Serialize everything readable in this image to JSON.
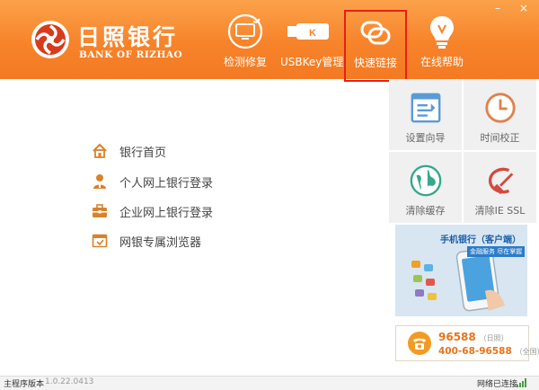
{
  "brand": {
    "name_cn": "日照银行",
    "name_en": "BANK OF RIZHAO",
    "accent": "#f7832a",
    "logo_red": "#d83a1c"
  },
  "window_controls": {
    "minimize": "–",
    "close": "×"
  },
  "toolbar": [
    {
      "label": "检测修复",
      "icon": "monitor-refresh-icon"
    },
    {
      "label": "USBKey管理",
      "icon": "usbkey-icon",
      "key_letter": "K"
    },
    {
      "label": "快速链接",
      "icon": "link-icon",
      "selected": true
    },
    {
      "label": "在线帮助",
      "icon": "lightbulb-icon"
    }
  ],
  "menu": [
    {
      "label": "银行首页",
      "icon": "home-icon"
    },
    {
      "label": "个人网上银行登录",
      "icon": "person-icon"
    },
    {
      "label": "企业网上银行登录",
      "icon": "briefcase-icon"
    },
    {
      "label": "网银专属浏览器",
      "icon": "browser-icon"
    }
  ],
  "tiles": [
    {
      "label": "设置向导",
      "icon": "wizard-icon"
    },
    {
      "label": "时间校正",
      "icon": "clock-icon"
    },
    {
      "label": "清除缓存",
      "icon": "globe-icon"
    },
    {
      "label": "清除IE SSL",
      "icon": "broom-icon"
    }
  ],
  "banner": {
    "title": "手机银行（客户端）",
    "subtitle": "金融服务 尽在掌握"
  },
  "hotline": {
    "number1": "96588",
    "note1": "（日照）",
    "number2": "400-68-96588",
    "note2": "（全国）"
  },
  "status": {
    "version_label": "主程序版本",
    "version": "1.0.22.0413",
    "network": "网络已连接"
  }
}
